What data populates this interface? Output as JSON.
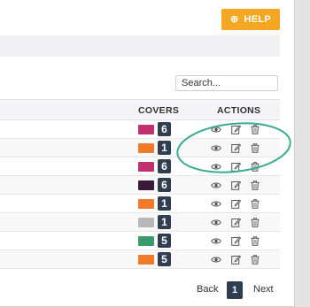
{
  "help_button": {
    "label": "HELP",
    "icon": "plus-circle-icon",
    "color": "#f5a623"
  },
  "search": {
    "placeholder": "Search..."
  },
  "table": {
    "columns": {
      "covers": "COVERS",
      "actions": "ACTIONS"
    },
    "rows": [
      {
        "count": "6",
        "thumb": "#c03070"
      },
      {
        "count": "1",
        "thumb": "#f07a2a"
      },
      {
        "count": "6",
        "thumb": "#c03070"
      },
      {
        "count": "6",
        "thumb": "#3a1a3a"
      },
      {
        "count": "1",
        "thumb": "#f07a2a"
      },
      {
        "count": "1",
        "thumb": "#b8b8b8"
      },
      {
        "count": "5",
        "thumb": "#3a9a6a"
      },
      {
        "count": "5",
        "thumb": "#f07a2a"
      }
    ],
    "actions": [
      "eye-icon",
      "edit-icon",
      "trash-icon"
    ]
  },
  "pagination": {
    "back": "Back",
    "current": "1",
    "next": "Next"
  },
  "annotation_color": "#3aaa90"
}
